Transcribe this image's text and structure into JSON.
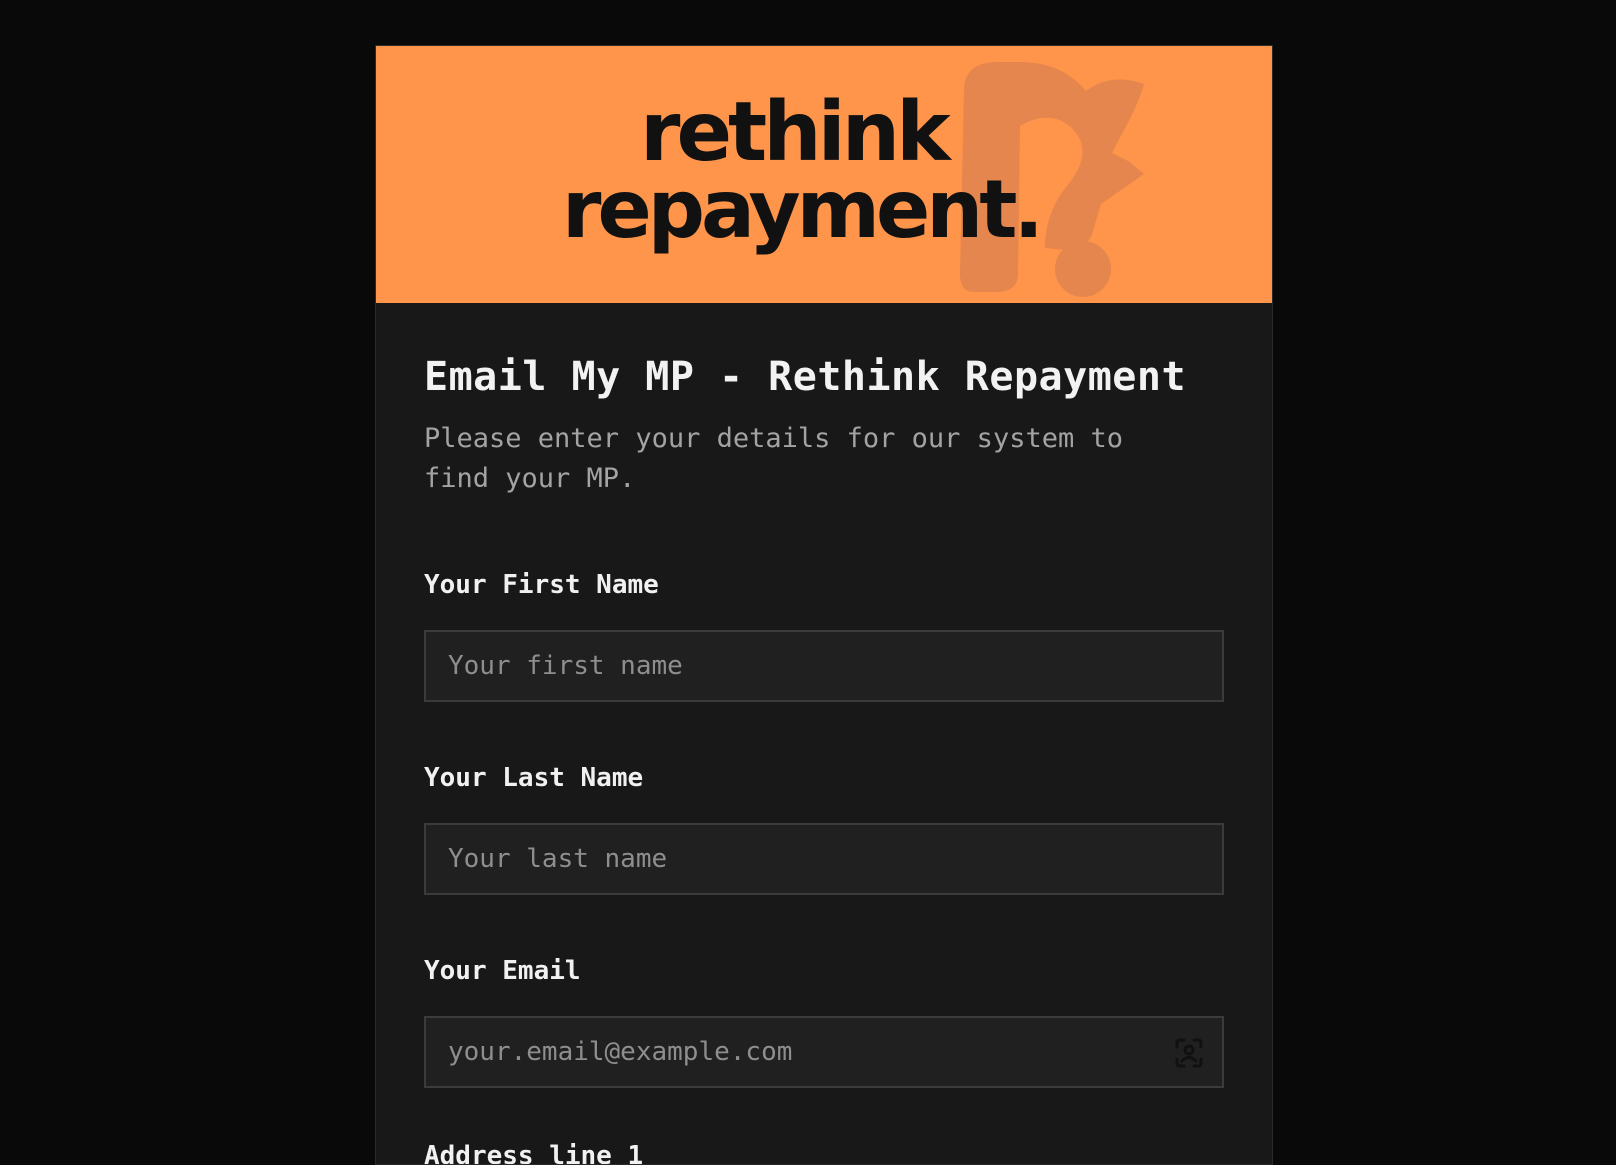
{
  "brand": {
    "logo_line1": "rethink",
    "logo_line2": "repayment.",
    "colors": {
      "banner": "#ff944b",
      "logo_text": "#111111",
      "logo_mark": "#e4864d",
      "page_background": "#090909",
      "card_background": "#181818"
    }
  },
  "form": {
    "title": "Email My MP - Rethink Repayment",
    "subtitle": "Please enter your details for our system to find your MP.",
    "fields": [
      {
        "label": "Your First Name",
        "placeholder": "Your first name",
        "value": ""
      },
      {
        "label": "Your Last Name",
        "placeholder": "Your last name",
        "value": ""
      },
      {
        "label": "Your Email",
        "placeholder": "your.email@example.com",
        "value": "",
        "icon": "contact-card-icon"
      }
    ],
    "next_label": "Address line 1"
  }
}
